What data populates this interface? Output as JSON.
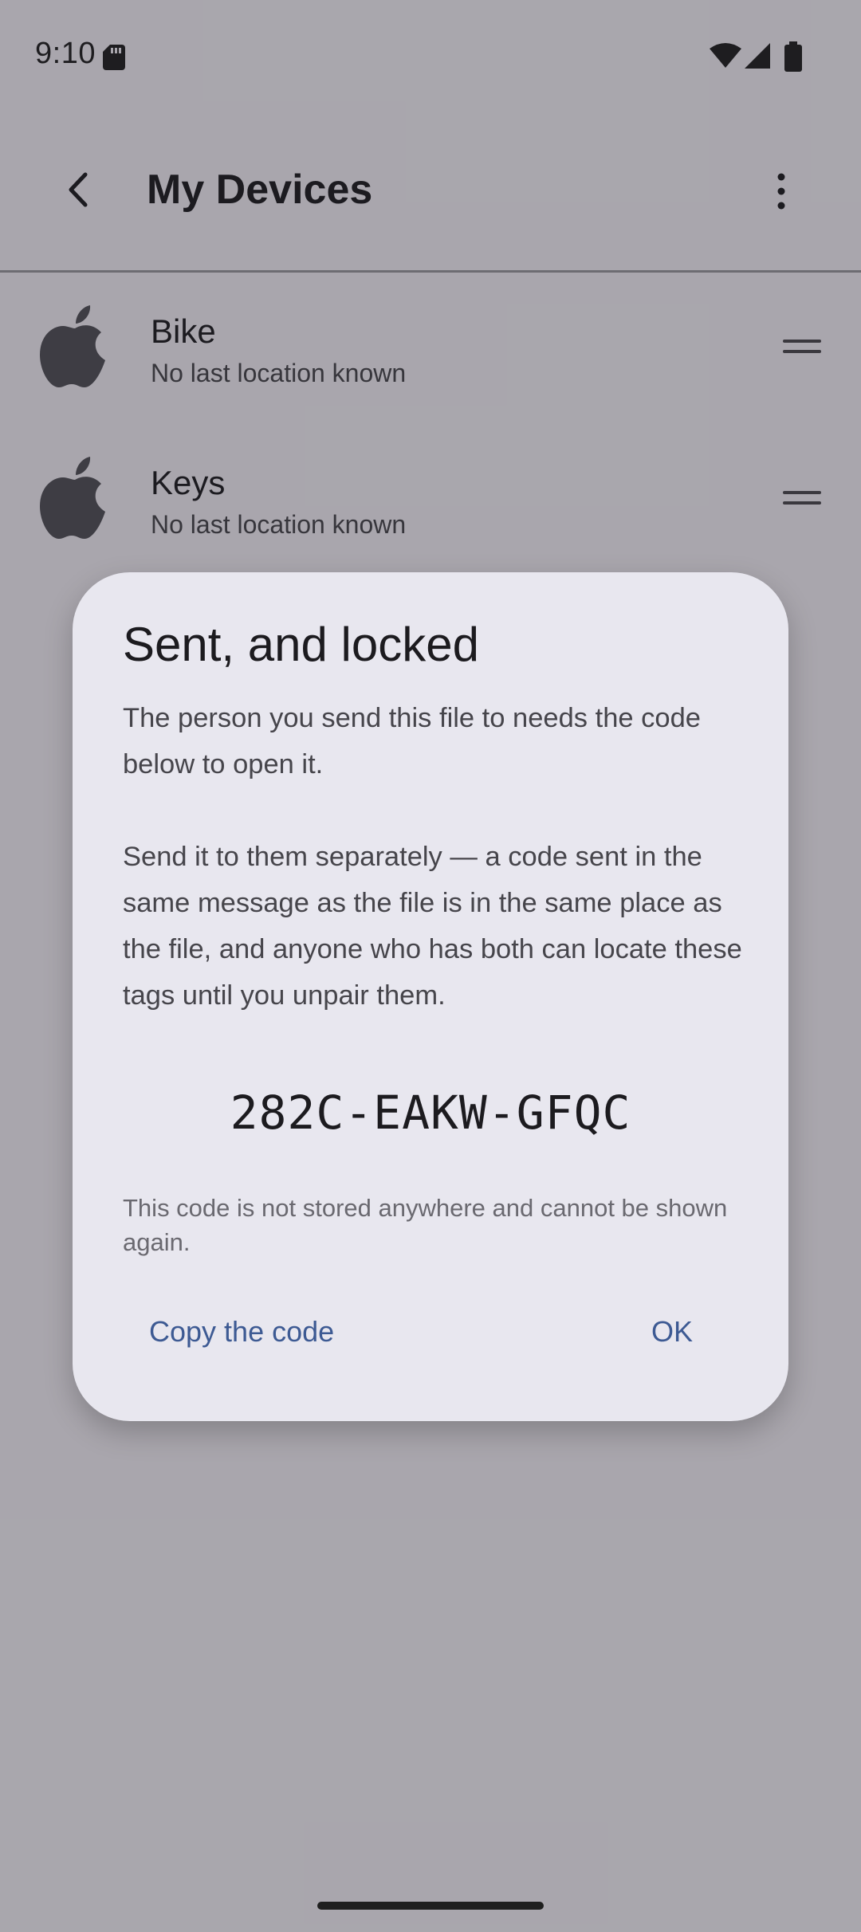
{
  "status_bar": {
    "time": "9:10",
    "icons": [
      "sd-card-icon",
      "wifi-icon",
      "cell-signal-icon",
      "battery-icon"
    ]
  },
  "app_bar": {
    "title": "My Devices",
    "back_icon": "chevron-left-icon",
    "menu_icon": "more-vert-icon"
  },
  "devices": [
    {
      "name": "Bike",
      "subtitle": "No last location known",
      "icon": "apple-icon"
    },
    {
      "name": "Keys",
      "subtitle": "No last location known",
      "icon": "apple-icon"
    }
  ],
  "dialog": {
    "title": "Sent, and locked",
    "body": [
      "The person you send this file to needs the code below to open it.",
      "Send it to them separately — a code sent in the same message as the file is in the same place as the file, and anyone who has both can locate these tags until you unpair them."
    ],
    "code": "282C-EAKW-GFQC",
    "note": "This code is not stored anywhere and cannot be shown again.",
    "buttons": {
      "copy": "Copy the code",
      "ok": "OK"
    }
  },
  "colors": {
    "background": "#f7f5fa",
    "dialog_surface": "#e8e7ef",
    "accent": "#3d5a93",
    "scrim": "rgba(30,28,36,0.36)"
  }
}
